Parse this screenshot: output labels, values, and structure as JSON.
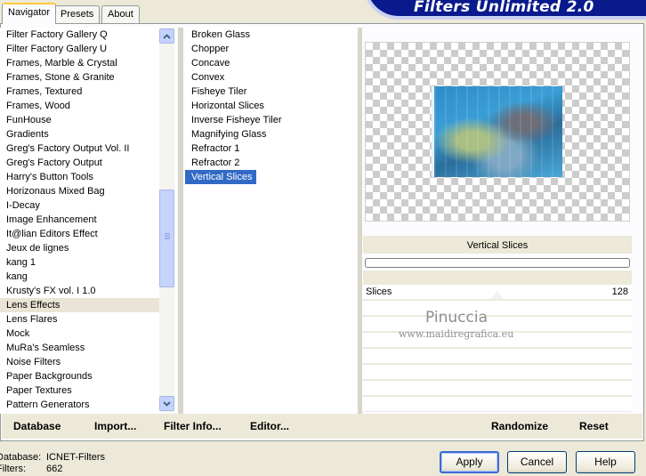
{
  "tabs": [
    "Navigator",
    "Presets",
    "About"
  ],
  "app_title": "Filters Unlimited 2.0",
  "categories": [
    "Filter Factory Gallery Q",
    "Filter Factory Gallery U",
    "Frames, Marble & Crystal",
    "Frames, Stone & Granite",
    "Frames, Textured",
    "Frames, Wood",
    "FunHouse",
    "Gradients",
    "Greg's Factory Output Vol. II",
    "Greg's Factory Output",
    "Harry's Button Tools",
    "Horizonaus Mixed Bag",
    "I-Decay",
    "Image Enhancement",
    "It@lian Editors Effect",
    "Jeux de lignes",
    "kang 1",
    "kang",
    "Krusty's FX vol. I 1.0",
    "Lens Effects",
    "Lens Flares",
    "Mock",
    "MuRa's Seamless",
    "Noise Filters",
    "Paper Backgrounds",
    "Paper Textures",
    "Pattern Generators"
  ],
  "selected_category": "Lens Effects",
  "filters": [
    "Broken Glass",
    "Chopper",
    "Concave",
    "Convex",
    "Fisheye Tiler",
    "Horizontal Slices",
    "Inverse Fisheye Tiler",
    "Magnifying Glass",
    "Refractor 1",
    "Refractor 2",
    "Vertical Slices"
  ],
  "selected_filter": "Vertical Slices",
  "filter_name": "Vertical Slices",
  "params": [
    {
      "label": "Slices",
      "value": "128"
    }
  ],
  "watermark": {
    "line1": "Pinuccia",
    "line2": "www.maidiregrafica.eu"
  },
  "panel_buttons": {
    "database": "Database",
    "import": "Import...",
    "filter_info": "Filter Info...",
    "editor": "Editor...",
    "randomize": "Randomize",
    "reset": "Reset"
  },
  "status": {
    "database_label": "Database:",
    "database_value": "ICNET-Filters",
    "filters_label": "Filters:",
    "filters_value": "662"
  },
  "dialog_buttons": {
    "apply": "Apply",
    "cancel": "Cancel",
    "help": "Help"
  }
}
